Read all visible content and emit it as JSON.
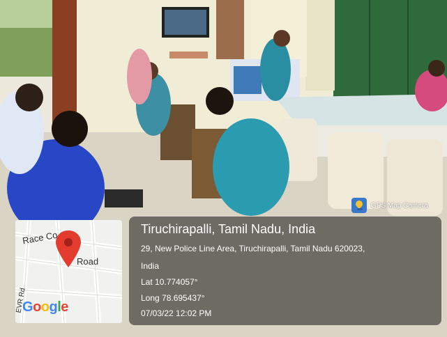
{
  "overlay": {
    "app_label": "GPS Map Camera",
    "location_title": "Tiruchirapalli, Tamil Nadu, India",
    "address_line_1": "29, New Police Line Area, Tiruchirapalli, Tamil Nadu 620023,",
    "address_line_2": "India",
    "latitude": "Lat 10.774057°",
    "longitude": "Long 78.695437°",
    "datetime": "07/03/22 12:02 PM"
  },
  "map": {
    "street_1": "Race Co",
    "street_2": "Road",
    "street_3": "EVR Rd",
    "logo": "Google"
  }
}
